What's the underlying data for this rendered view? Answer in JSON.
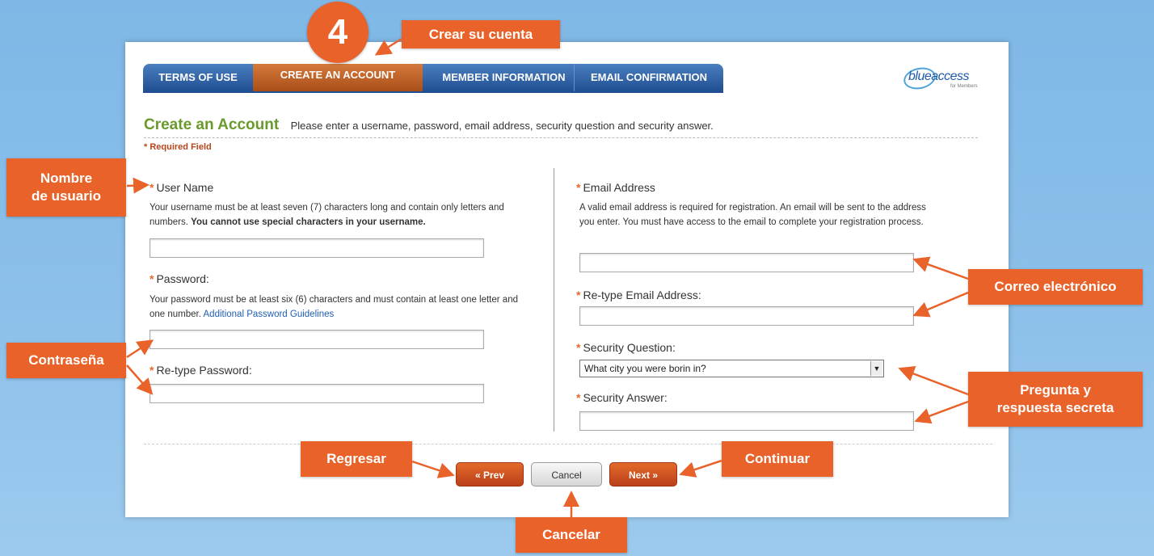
{
  "step": {
    "number": "4",
    "label": "Crear su cuenta"
  },
  "tabs": [
    {
      "label": "TERMS OF USE"
    },
    {
      "label": "CREATE AN ACCOUNT"
    },
    {
      "label": "MEMBER INFORMATION"
    },
    {
      "label": "EMAIL CONFIRMATION"
    }
  ],
  "logo": {
    "brand": "blueaccess",
    "sub": "for Members"
  },
  "form": {
    "title": "Create an Account",
    "description": "Please enter a username, password, email address, security question and security answer.",
    "required_note": "Required Field",
    "required_marker": "*",
    "username": {
      "label": "User Name",
      "help": "Your username must be at least seven (7) characters long and contain only letters and numbers.",
      "help_bold": "You cannot use special characters in your username.",
      "value": ""
    },
    "password": {
      "label": "Password:",
      "help": "Your password must be at least six (6) characters and must contain at least one letter and one number.",
      "link": "Additional Password Guidelines",
      "value": ""
    },
    "retype_password": {
      "label": "Re-type Password:",
      "value": ""
    },
    "email": {
      "label": "Email Address",
      "help": "A valid email address is required for registration. An email will be sent to the address you enter. You must have access to the email to complete your registration process.",
      "value": ""
    },
    "retype_email": {
      "label": "Re-type Email Address:",
      "value": ""
    },
    "security_question": {
      "label": "Security Question:",
      "selected": "What city you were borin in?"
    },
    "security_answer": {
      "label": "Security Answer:",
      "value": ""
    }
  },
  "buttons": {
    "prev": "« Prev",
    "cancel": "Cancel",
    "next": "Next »"
  },
  "callouts": {
    "username": [
      "Nombre",
      "de usuario"
    ],
    "password": "Contraseña",
    "email": "Correo electrónico",
    "security": [
      "Pregunta y",
      "respuesta secreta"
    ],
    "prev": "Regresar",
    "next": "Continuar",
    "cancel": "Cancelar"
  },
  "colors": {
    "accent": "#e8622a",
    "tab_blue": "#1f4f92",
    "title_green": "#6a9a2c"
  }
}
